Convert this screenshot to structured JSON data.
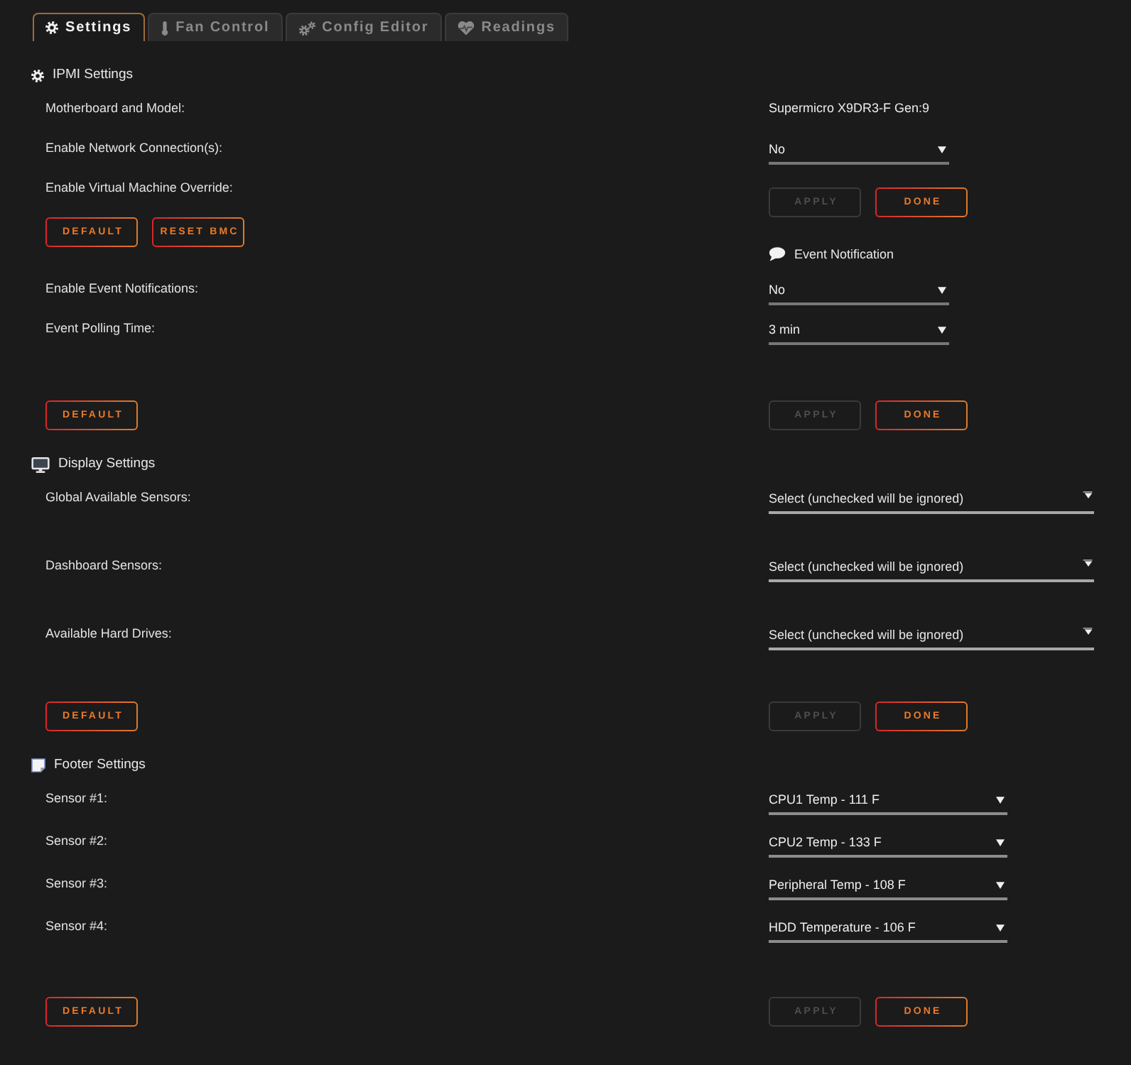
{
  "tabs": [
    {
      "label": "Settings",
      "selected": true
    },
    {
      "label": "Fan Control",
      "selected": false
    },
    {
      "label": "Config Editor",
      "selected": false
    },
    {
      "label": "Readings",
      "selected": false
    }
  ],
  "sections": [
    {
      "title": "IPMI Settings",
      "rows": [
        {
          "left": [
            {
              "kind": "label",
              "text": "Motherboard and Model:"
            }
          ],
          "right": [
            {
              "kind": "text",
              "text": "Supermicro X9DR3-F Gen:9"
            }
          ]
        },
        {
          "left": [
            {
              "kind": "label",
              "text": "Enable Network Connection(s):"
            }
          ],
          "right": [
            {
              "kind": "select",
              "value": "No"
            }
          ]
        },
        {
          "left": [
            {
              "kind": "label",
              "text": "Enable Virtual Machine Override:"
            }
          ],
          "right": [
            {
              "kind": "button",
              "label": "APPLY",
              "disabled": true
            },
            {
              "kind": "button",
              "label": "DONE",
              "disabled": false
            }
          ]
        },
        {
          "left": [
            {
              "kind": "button",
              "label": "DEFAULT",
              "disabled": false
            },
            {
              "kind": "button",
              "label": "RESET BMC",
              "disabled": false
            }
          ],
          "right": [
            {
              "kind": "heading",
              "text": "Event Notification"
            }
          ]
        },
        {
          "left": [
            {
              "kind": "label",
              "text": "Enable Event Notifications:"
            }
          ],
          "right": [
            {
              "kind": "select",
              "value": "No"
            }
          ]
        },
        {
          "left": [
            {
              "kind": "label",
              "text": "Event Polling Time:"
            }
          ],
          "right": [
            {
              "kind": "select",
              "value": "3 min"
            }
          ]
        },
        {
          "left": [
            {
              "kind": "button",
              "label": "DEFAULT",
              "disabled": false
            }
          ],
          "right": [
            {
              "kind": "button",
              "label": "APPLY",
              "disabled": true
            },
            {
              "kind": "button",
              "label": "DONE",
              "disabled": false
            }
          ]
        }
      ]
    },
    {
      "title": "Display Settings",
      "rows": [
        {
          "left": [
            {
              "kind": "label",
              "text": "Global Available Sensors:"
            }
          ],
          "right": [
            {
              "kind": "multiselect",
              "placeholder": "Select (unchecked will be ignored)"
            }
          ]
        },
        {
          "left": [
            {
              "kind": "label",
              "text": "Dashboard Sensors:"
            }
          ],
          "right": [
            {
              "kind": "multiselect",
              "placeholder": "Select (unchecked will be ignored)"
            }
          ]
        },
        {
          "left": [
            {
              "kind": "label",
              "text": "Available Hard Drives:"
            }
          ],
          "right": [
            {
              "kind": "multiselect",
              "placeholder": "Select (unchecked will be ignored)"
            }
          ]
        },
        {
          "left": [
            {
              "kind": "button",
              "label": "DEFAULT",
              "disabled": false
            }
          ],
          "right": [
            {
              "kind": "button",
              "label": "APPLY",
              "disabled": true
            },
            {
              "kind": "button",
              "label": "DONE",
              "disabled": false
            }
          ]
        }
      ]
    },
    {
      "title": "Footer Settings",
      "rows": [
        {
          "left": [
            {
              "kind": "label",
              "text": "Sensor #1:"
            }
          ],
          "right": [
            {
              "kind": "select",
              "value": "CPU1 Temp - 111 F"
            }
          ]
        },
        {
          "left": [
            {
              "kind": "label",
              "text": "Sensor #2:"
            }
          ],
          "right": [
            {
              "kind": "select",
              "value": "CPU2 Temp - 133 F"
            }
          ]
        },
        {
          "left": [
            {
              "kind": "label",
              "text": "Sensor #3:"
            }
          ],
          "right": [
            {
              "kind": "select",
              "value": "Peripheral Temp - 108 F"
            }
          ]
        },
        {
          "left": [
            {
              "kind": "label",
              "text": "Sensor #4:"
            }
          ],
          "right": [
            {
              "kind": "select",
              "value": "HDD Temperature - 106 F"
            }
          ]
        },
        {
          "left": [
            {
              "kind": "button",
              "label": "DEFAULT",
              "disabled": false
            }
          ],
          "right": [
            {
              "kind": "button",
              "label": "APPLY",
              "disabled": true
            },
            {
              "kind": "button",
              "label": "DONE",
              "disabled": false
            }
          ]
        }
      ]
    }
  ]
}
